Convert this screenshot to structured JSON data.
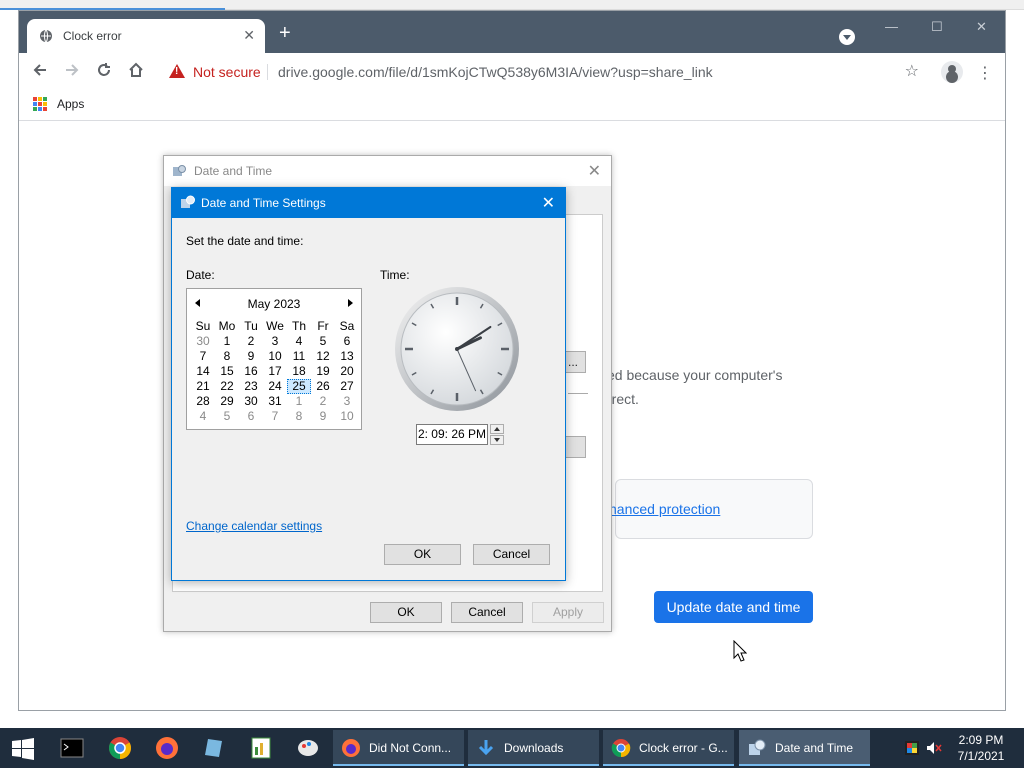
{
  "browser": {
    "tab_title": "Clock error",
    "tab_close": "✕",
    "new_tab": "+",
    "window_min": "—",
    "window_max": "☐",
    "window_close": "✕",
    "security_label": "Not secure",
    "url": "drive.google.com/file/d/1smKojCTwQ538y6M3IA/view?usp=share_link",
    "bookmarks_apps": "Apps",
    "accent": "#1a73e8",
    "title_bar_color": "#4c5b6b"
  },
  "page": {
    "text_line1": "ed because your computer's",
    "text_line2": "rrect.",
    "link_text": "nanced protection",
    "update_button": "Update date and time",
    "ghost_button_text": "..."
  },
  "outer_dialog": {
    "title": "Date and Time",
    "close": "✕",
    "ok": "OK",
    "cancel": "Cancel",
    "apply": "Apply"
  },
  "inner_dialog": {
    "title": "Date and Time Settings",
    "close": "✕",
    "instruction": "Set the date and time:",
    "date_label": "Date:",
    "time_label": "Time:",
    "calendar": {
      "month": "May 2023",
      "weekdays": [
        "Su",
        "Mo",
        "Tu",
        "We",
        "Th",
        "Fr",
        "Sa"
      ],
      "weeks": [
        [
          {
            "d": "30",
            "m": true
          },
          {
            "d": "1"
          },
          {
            "d": "2"
          },
          {
            "d": "3"
          },
          {
            "d": "4"
          },
          {
            "d": "5"
          },
          {
            "d": "6"
          }
        ],
        [
          {
            "d": "7"
          },
          {
            "d": "8"
          },
          {
            "d": "9"
          },
          {
            "d": "10"
          },
          {
            "d": "11"
          },
          {
            "d": "12"
          },
          {
            "d": "13"
          }
        ],
        [
          {
            "d": "14"
          },
          {
            "d": "15"
          },
          {
            "d": "16"
          },
          {
            "d": "17"
          },
          {
            "d": "18"
          },
          {
            "d": "19"
          },
          {
            "d": "20"
          }
        ],
        [
          {
            "d": "21"
          },
          {
            "d": "22"
          },
          {
            "d": "23"
          },
          {
            "d": "24"
          },
          {
            "d": "25",
            "s": true
          },
          {
            "d": "26"
          },
          {
            "d": "27"
          }
        ],
        [
          {
            "d": "28"
          },
          {
            "d": "29"
          },
          {
            "d": "30"
          },
          {
            "d": "31"
          },
          {
            "d": "1",
            "m": true
          },
          {
            "d": "2",
            "m": true
          },
          {
            "d": "3",
            "m": true
          }
        ],
        [
          {
            "d": "4",
            "m": true
          },
          {
            "d": "5",
            "m": true
          },
          {
            "d": "6",
            "m": true
          },
          {
            "d": "7",
            "m": true
          },
          {
            "d": "8",
            "m": true
          },
          {
            "d": "9",
            "m": true
          },
          {
            "d": "10",
            "m": true
          }
        ]
      ],
      "selected_day": "25"
    },
    "time_value": "2: 09: 26 PM",
    "clock": {
      "hour": 2,
      "minute": 9,
      "second": 26
    },
    "change_calendar_link": "Change calendar settings",
    "ok": "OK",
    "cancel": "Cancel"
  },
  "taskbar": {
    "tasks": [
      {
        "label": "Did Not Conn...",
        "icon": "firefox-icon"
      },
      {
        "label": "Downloads",
        "icon": "download-folder-icon"
      },
      {
        "label": "Clock error - G...",
        "icon": "chrome-icon"
      },
      {
        "label": "Date and Time",
        "icon": "date-time-icon"
      }
    ],
    "time": "2:09 PM",
    "date": "7/1/2021"
  }
}
